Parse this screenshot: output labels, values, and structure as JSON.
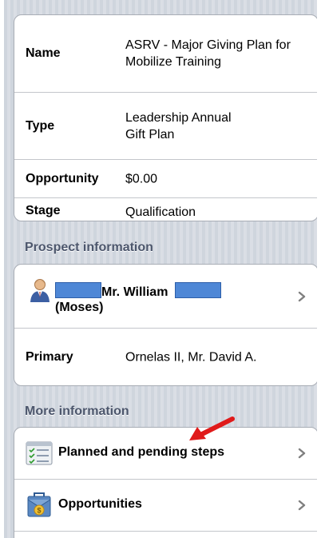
{
  "details": {
    "name_label": "Name",
    "name_value": "ASRV - Major Giving Plan for Mobilize Training",
    "type_label": "Type",
    "type_value": "Leadership Annual Gift Plan",
    "opportunity_label": "Opportunity",
    "opportunity_value": "$0.00",
    "stage_label": "Stage",
    "stage_value": "Qualification"
  },
  "prospect_section": {
    "header": "Prospect information",
    "prospect_name": "Mr. William",
    "prospect_nickname": "(Moses)",
    "primary_label": "Primary",
    "primary_value": "Ornelas II, Mr. David A."
  },
  "more_section": {
    "header": "More information",
    "items": [
      {
        "label": "Planned and pending steps",
        "icon": "checklist-icon"
      },
      {
        "label": "Opportunities",
        "icon": "opportunities-icon"
      }
    ]
  },
  "colors": {
    "background_stripe": "#d5dae2",
    "section_header": "#4c566c",
    "redaction": "#4e87d6",
    "annotation_arrow": "#e01a1a"
  }
}
